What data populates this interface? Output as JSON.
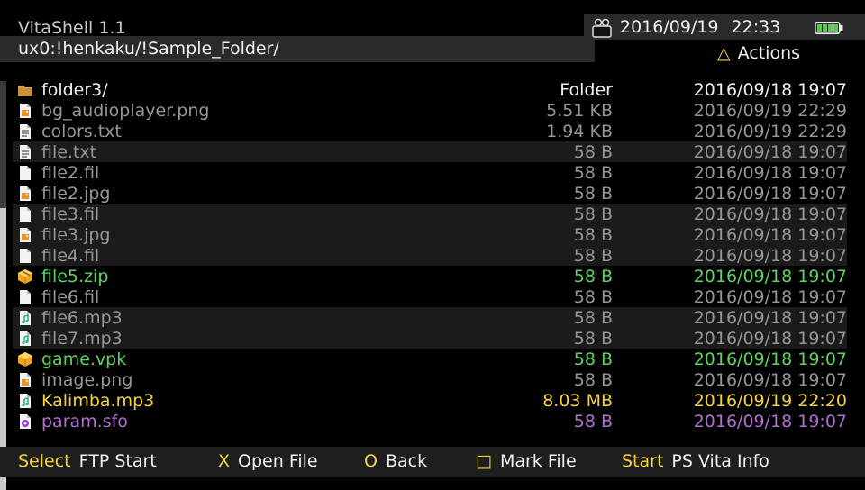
{
  "app": {
    "title": "VitaShell 1.1"
  },
  "path": "ux0:!henkaku/!Sample_Folder/",
  "status": {
    "date": "2016/09/19",
    "time": "22:33",
    "battery_level": 1.0,
    "actions_button": "△",
    "actions_label": "Actions"
  },
  "colors": {
    "default": "#969696",
    "folder": "#f0f0f0",
    "archive": "#5fd35f",
    "playing": "#f5d23a",
    "sfo": "#b070d0"
  },
  "files": [
    {
      "name": "folder3/",
      "size": "Folder",
      "date": "2016/09/18 19:07",
      "icon": "folder-icon",
      "kind": "folder",
      "alt": false
    },
    {
      "name": "bg_audioplayer.png",
      "size": "5.51 KB",
      "date": "2016/09/19 22:29",
      "icon": "image-file-icon",
      "kind": "default",
      "alt": false
    },
    {
      "name": "colors.txt",
      "size": "1.94 KB",
      "date": "2016/09/19 22:29",
      "icon": "text-file-icon",
      "kind": "default",
      "alt": false
    },
    {
      "name": "file.txt",
      "size": "58 B",
      "date": "2016/09/18 19:07",
      "icon": "text-file-icon",
      "kind": "default",
      "alt": true
    },
    {
      "name": "file2.fil",
      "size": "58 B",
      "date": "2016/09/18 19:07",
      "icon": "file-icon",
      "kind": "default",
      "alt": false
    },
    {
      "name": "file2.jpg",
      "size": "58 B",
      "date": "2016/09/18 19:07",
      "icon": "image-file-icon",
      "kind": "default",
      "alt": false
    },
    {
      "name": "file3.fil",
      "size": "58 B",
      "date": "2016/09/18 19:07",
      "icon": "file-icon",
      "kind": "default",
      "alt": true
    },
    {
      "name": "file3.jpg",
      "size": "58 B",
      "date": "2016/09/18 19:07",
      "icon": "image-file-icon",
      "kind": "default",
      "alt": true
    },
    {
      "name": "file4.fil",
      "size": "58 B",
      "date": "2016/09/18 19:07",
      "icon": "file-icon",
      "kind": "default",
      "alt": true
    },
    {
      "name": "file5.zip",
      "size": "58 B",
      "date": "2016/09/18 19:07",
      "icon": "archive-icon",
      "kind": "archive",
      "alt": false
    },
    {
      "name": "file6.fil",
      "size": "58 B",
      "date": "2016/09/18 19:07",
      "icon": "file-icon",
      "kind": "default",
      "alt": false
    },
    {
      "name": "file6.mp3",
      "size": "58 B",
      "date": "2016/09/18 19:07",
      "icon": "audio-file-icon",
      "kind": "default",
      "alt": true
    },
    {
      "name": "file7.mp3",
      "size": "58 B",
      "date": "2016/09/18 19:07",
      "icon": "audio-file-icon",
      "kind": "default",
      "alt": true
    },
    {
      "name": "game.vpk",
      "size": "58 B",
      "date": "2016/09/18 19:07",
      "icon": "package-icon",
      "kind": "archive",
      "alt": false
    },
    {
      "name": "image.png",
      "size": "58 B",
      "date": "2016/09/18 19:07",
      "icon": "image-file-icon",
      "kind": "default",
      "alt": false
    },
    {
      "name": "Kalimba.mp3",
      "size": "8.03 MB",
      "date": "2016/09/19 22:20",
      "icon": "audio-file-icon",
      "kind": "playing",
      "alt": false
    },
    {
      "name": "param.sfo",
      "size": "58 B",
      "date": "2016/09/18 19:07",
      "icon": "sfo-file-icon",
      "kind": "sfo",
      "alt": false
    }
  ],
  "footer": {
    "hints": [
      {
        "button": "Select",
        "label": "FTP Start"
      },
      {
        "button": "X",
        "label": "Open File"
      },
      {
        "button": "O",
        "label": "Back"
      },
      {
        "button": "□",
        "label": "Mark File"
      },
      {
        "button": "Start",
        "label": "PS Vita Info"
      }
    ]
  }
}
